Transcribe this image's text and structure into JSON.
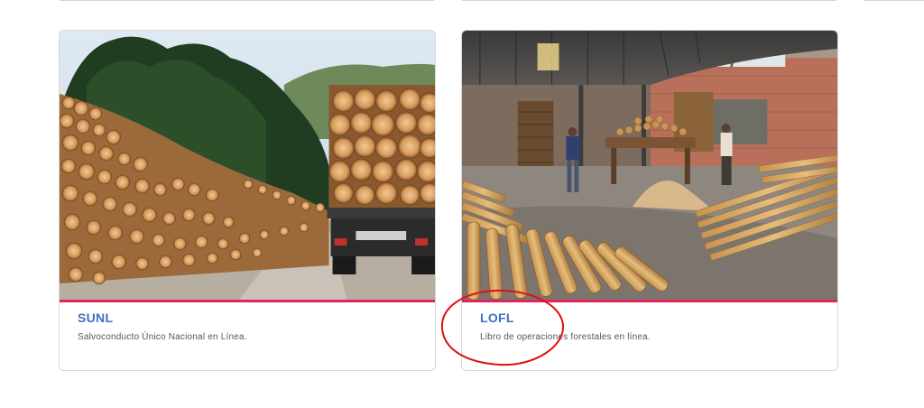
{
  "cards": [
    {
      "title": "SUNL",
      "description": "Salvoconducto Único Nacional en Línea.",
      "image": "timber-logs-truck-photo"
    },
    {
      "title": "LOFL",
      "description": "Libro de operaciones forestales en línea.",
      "image": "sawmill-warehouse-photo"
    }
  ],
  "colors": {
    "accent": "#e0245e",
    "title": "#3f6fc4",
    "annotation": "#e01010"
  }
}
